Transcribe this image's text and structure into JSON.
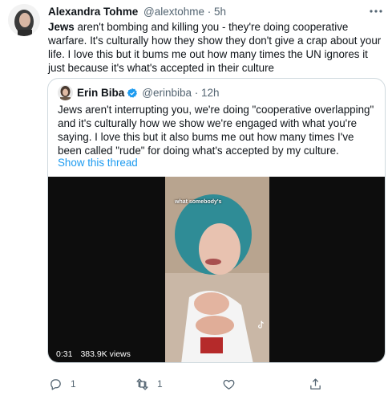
{
  "tweet": {
    "author_name": "Alexandra Tohme",
    "author_meta": "@alextohme · 5h",
    "text_bold": "Jews",
    "text_rest": " aren't bombing and killing you - they're doing cooperative warfare. It's culturally how they show they don't give a crap about your life. I love this but it bums me out how many times the UN ignores it just because it's what's accepted in their culture",
    "actions": {
      "reply_count": "1",
      "retweet_count": "1",
      "like_count": "",
      "share_count": ""
    }
  },
  "quoted": {
    "author_name": "Erin Biba",
    "author_meta": "@erinbiba · 12h",
    "text": "Jews aren't interrupting you, we're doing \"cooperative overlapping\" and it's culturally how we show we're engaged with what you're saying. I love this but it also bums me out how many times I've been called \"rude\" for doing what's accepted by my culture.",
    "show_thread": "Show this thread",
    "video": {
      "caption": "what somebody's",
      "duration": "0:31",
      "views": "383.9K views"
    }
  },
  "colors": {
    "link": "#1d9bf0",
    "secondary_text": "#536471",
    "border": "#cfd9de",
    "video_bg": "#0d0d0d"
  },
  "icons": [
    "more-icon",
    "verified-icon",
    "reply-icon",
    "retweet-icon",
    "like-icon",
    "share-icon",
    "tiktok-icon"
  ]
}
